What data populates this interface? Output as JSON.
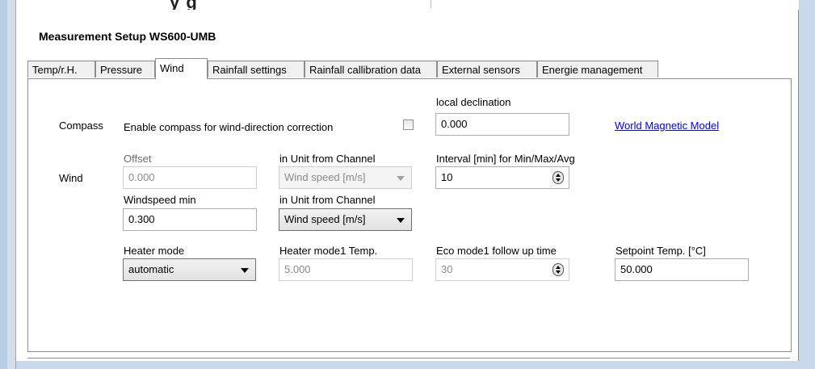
{
  "top_fragment": "y  g",
  "heading": "Measurement Setup  WS600-UMB",
  "tabs": [
    {
      "label": "Temp/r.H."
    },
    {
      "label": "Pressure"
    },
    {
      "label": "Wind"
    },
    {
      "label": "Rainfall settings"
    },
    {
      "label": "Rainfall callibration data"
    },
    {
      "label": "External sensors"
    },
    {
      "label": "Energie management"
    }
  ],
  "active_tab": "Wind",
  "compass": {
    "section_label": "Compass",
    "enable_label": "Enable compass for wind-direction correction",
    "enable_checked": false,
    "declination_label": "local declination",
    "declination_value": "0.000",
    "link_text": "World Magnetic Model"
  },
  "wind": {
    "section_label": "Wind",
    "offset_label": "Offset",
    "offset_value": "0.000",
    "offset_unit_label": "in Unit from Channel",
    "offset_unit_value": "Wind speed [m/s]",
    "interval_label": "Interval [min] for Min/Max/Avg",
    "interval_value": "10",
    "windspeed_min_label": "Windspeed min",
    "windspeed_min_value": "0.300",
    "min_unit_label": "in Unit from Channel",
    "min_unit_value": "Wind speed [m/s]"
  },
  "heater": {
    "mode_label": "Heater mode",
    "mode_value": "automatic",
    "mode1_temp_label": "Heater mode1 Temp.",
    "mode1_temp_value": "5.000",
    "eco_label": "Eco mode1 follow up time",
    "eco_value": "30",
    "setpoint_label": "Setpoint Temp. [°C]",
    "setpoint_value": "50.000"
  }
}
